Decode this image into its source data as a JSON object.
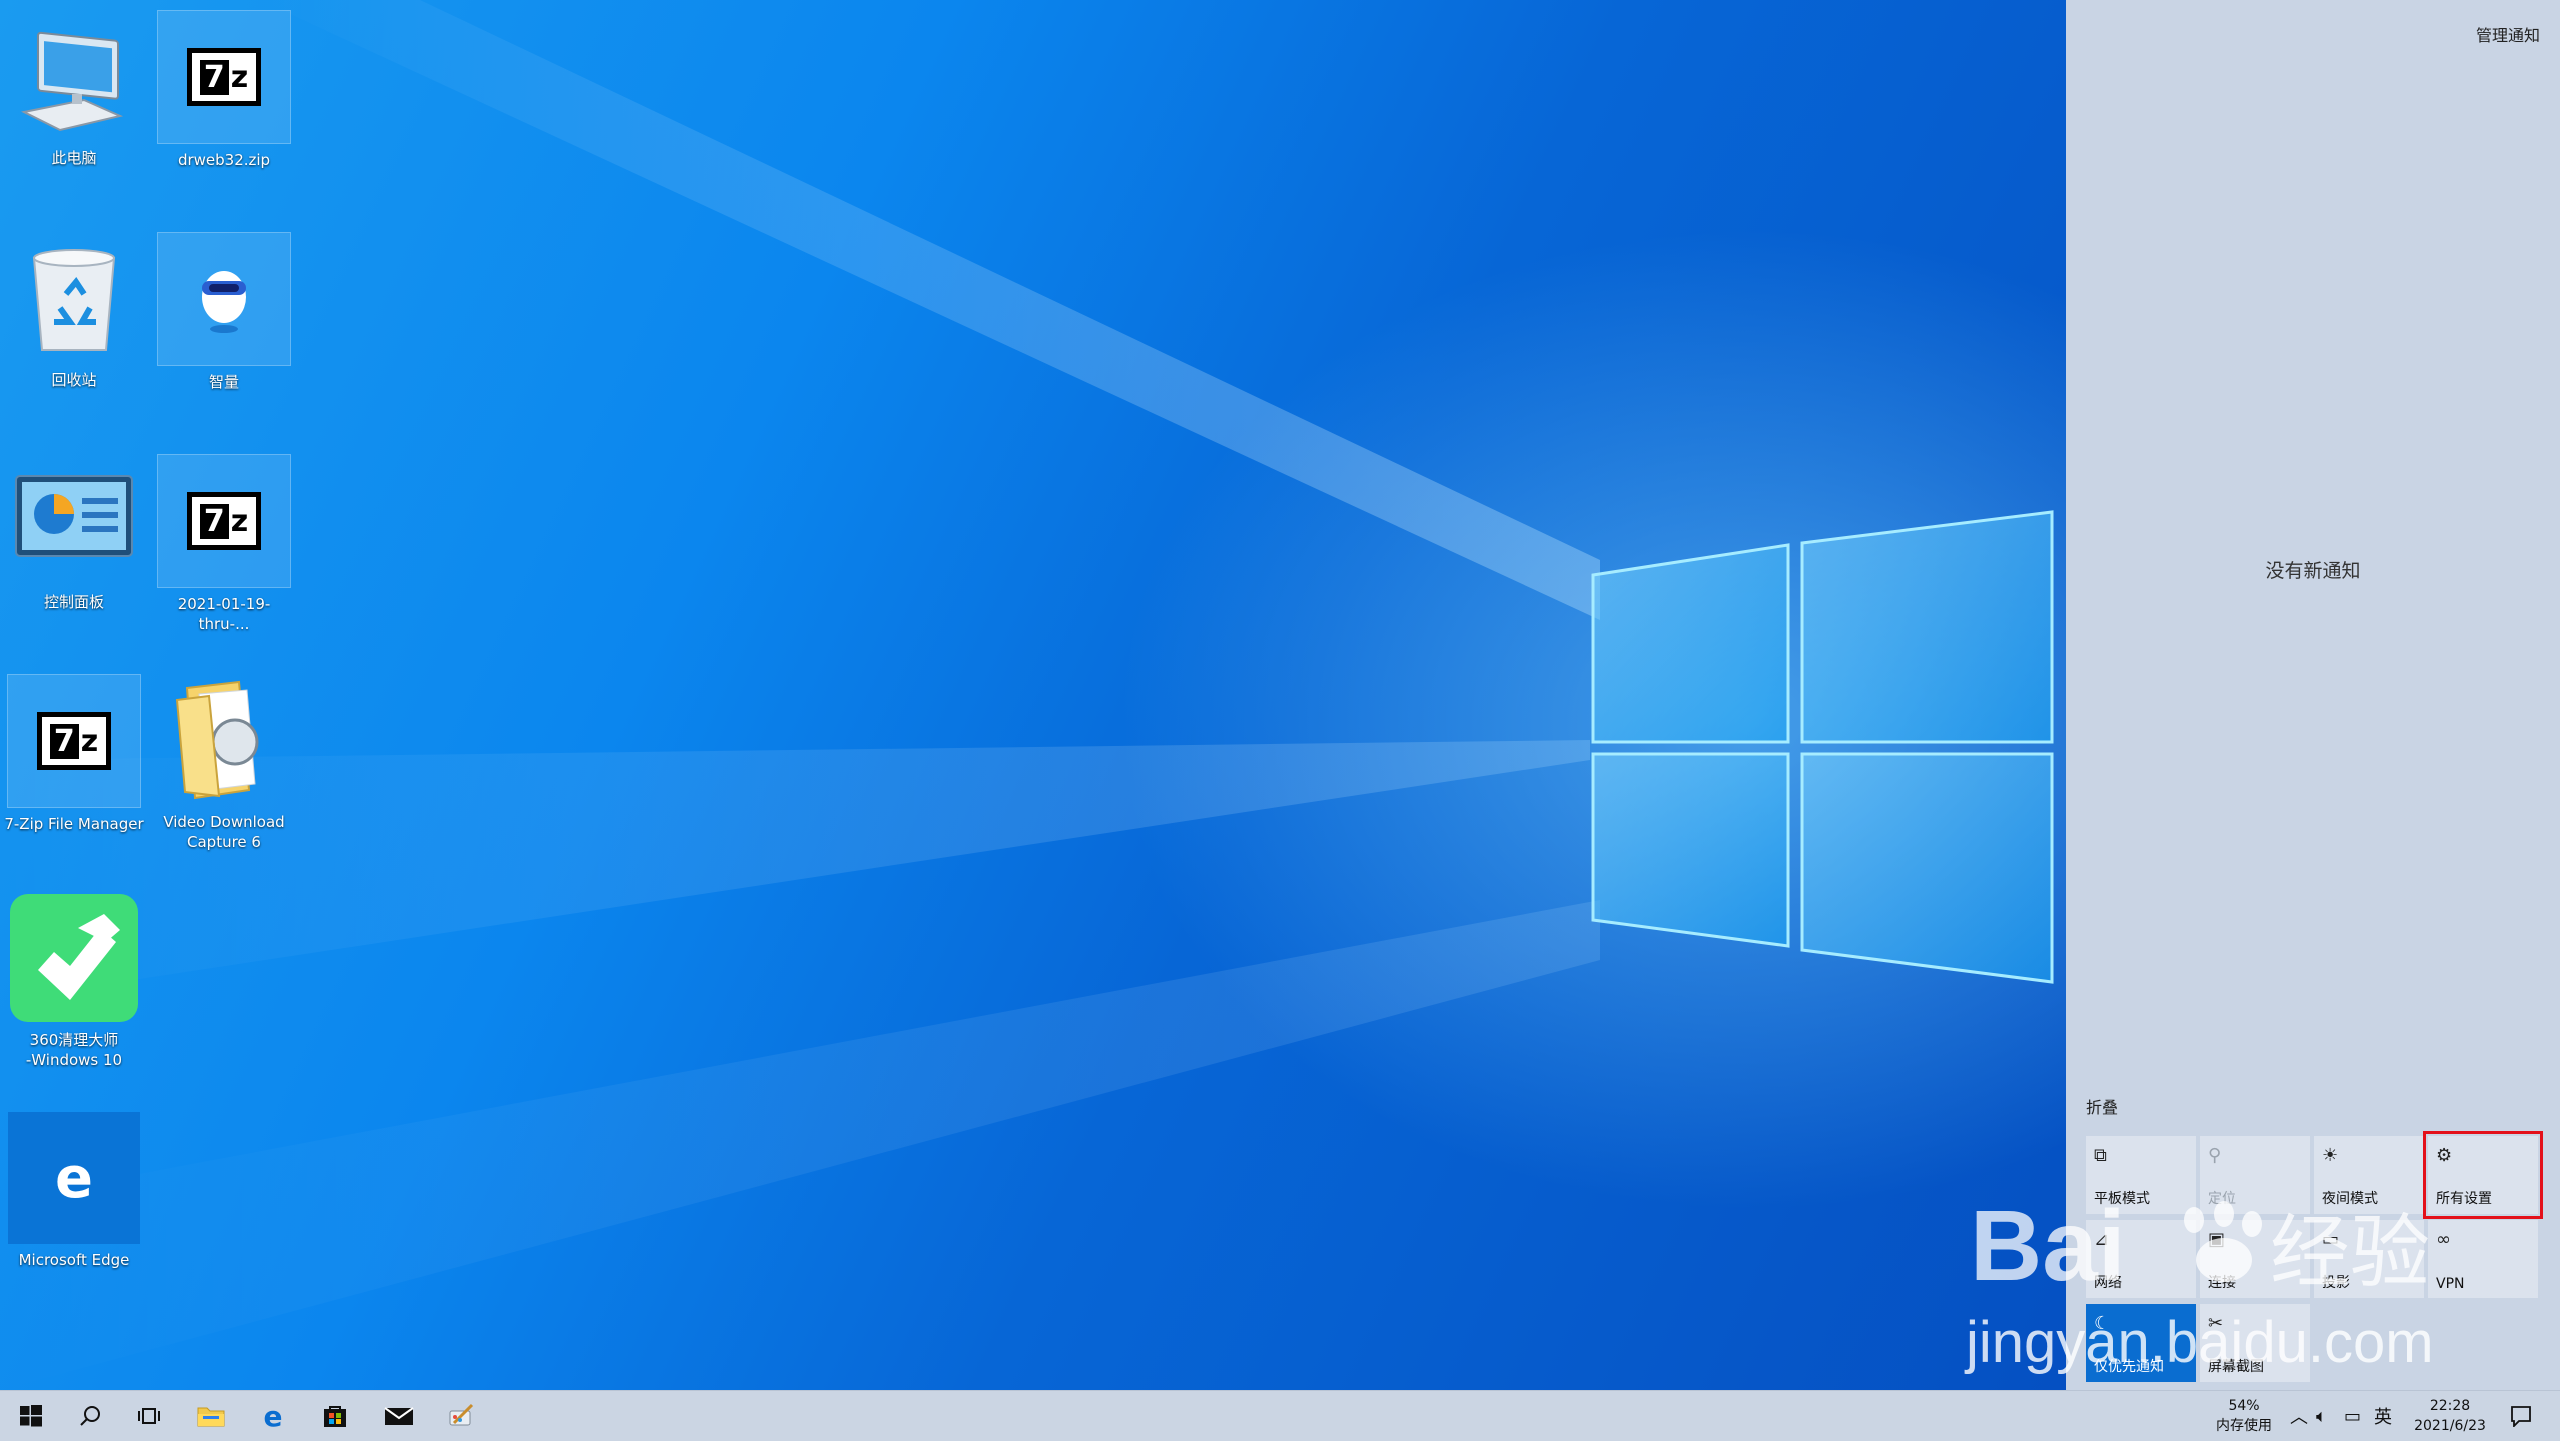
{
  "desktop": {
    "icons": [
      {
        "label": "此电脑"
      },
      {
        "label": "drweb32.zip"
      },
      {
        "label": "回收站"
      },
      {
        "label": "智量"
      },
      {
        "label": "控制面板"
      },
      {
        "label": "2021-01-19-thru-..."
      },
      {
        "label": "7-Zip File Manager"
      },
      {
        "label": "Video Download\nCapture 6"
      },
      {
        "label": "360清理大师\n-Windows 10"
      },
      {
        "label": "Microsoft Edge"
      }
    ]
  },
  "action_center": {
    "manage_notifications": "管理通知",
    "no_new_notifications": "没有新通知",
    "collapse_label": "折叠",
    "tiles": [
      {
        "label": "平板模式",
        "icon": "tablet-mode-icon"
      },
      {
        "label": "定位",
        "icon": "location-icon"
      },
      {
        "label": "夜间模式",
        "icon": "night-light-icon"
      },
      {
        "label": "所有设置",
        "icon": "gear-icon"
      },
      {
        "label": "网络",
        "icon": "network-icon"
      },
      {
        "label": "连接",
        "icon": "connect-icon"
      },
      {
        "label": "投影",
        "icon": "project-icon"
      },
      {
        "label": "VPN",
        "icon": "vpn-icon"
      },
      {
        "label": "仅优先通知",
        "icon": "moon-icon"
      },
      {
        "label": "屏幕截图",
        "icon": "screen-snip-icon"
      }
    ],
    "highlight_color": "#e3101a",
    "active_color": "#0a6dd0"
  },
  "taskbar": {
    "memory_percent": "54%",
    "memory_label": "内存使用",
    "input_method": "英",
    "time": "22:28",
    "date": "2021/6/23"
  },
  "watermark": {
    "brand": "Bai",
    "brand_cn": "经验",
    "url": "jingyan.baidu.com"
  }
}
